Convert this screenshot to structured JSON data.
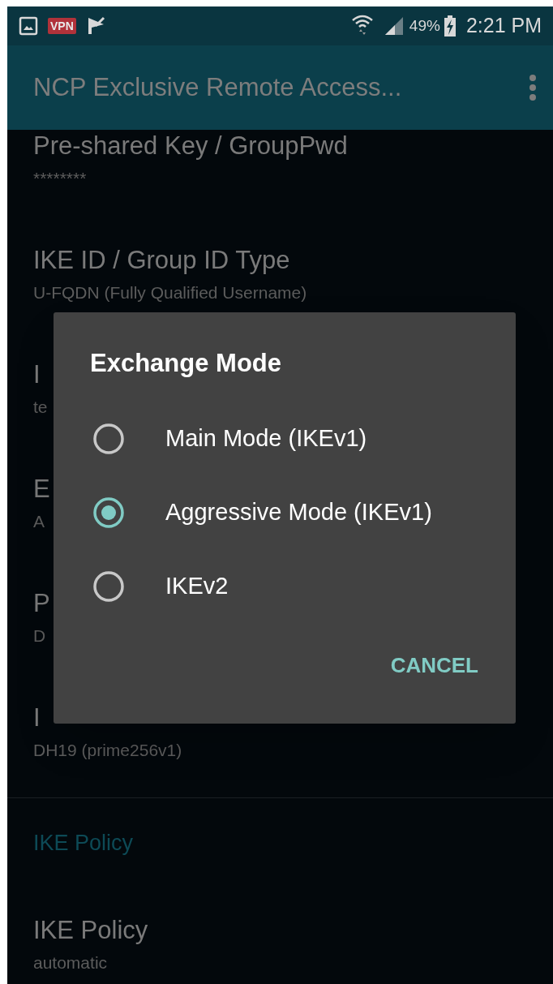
{
  "status_bar": {
    "vpn": "VPN",
    "battery": "49%",
    "time": "2:21 PM"
  },
  "app_bar": {
    "title": "NCP Exclusive Remote Access..."
  },
  "settings": [
    {
      "kind": "item",
      "title": "Pre-shared Key / GroupPwd",
      "summary": "********"
    },
    {
      "kind": "item",
      "title": "IKE ID / Group ID Type",
      "summary": "U-FQDN (Fully Qualified Username)"
    },
    {
      "kind": "item",
      "title": "I",
      "summary": "te"
    },
    {
      "kind": "item",
      "title": "E",
      "summary": "A"
    },
    {
      "kind": "item",
      "title": "P",
      "summary": "D"
    },
    {
      "kind": "item",
      "title": "I",
      "summary": "DH19 (prime256v1)"
    },
    {
      "kind": "divider"
    },
    {
      "kind": "header",
      "title": "IKE Policy"
    },
    {
      "kind": "item",
      "title": "IKE Policy",
      "summary": "automatic"
    }
  ],
  "dialog": {
    "title": "Exchange Mode",
    "options": [
      {
        "label": "Main Mode (IKEv1)",
        "selected": false
      },
      {
        "label": "Aggressive Mode (IKEv1)",
        "selected": true
      },
      {
        "label": "IKEv2",
        "selected": false
      }
    ],
    "button": "CANCEL"
  }
}
